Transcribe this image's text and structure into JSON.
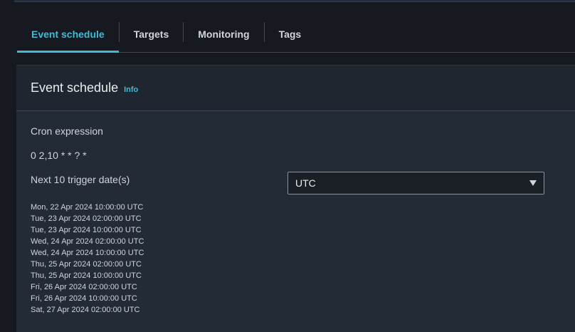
{
  "tabs": [
    {
      "label": "Event schedule",
      "active": true
    },
    {
      "label": "Targets",
      "active": false
    },
    {
      "label": "Monitoring",
      "active": false
    },
    {
      "label": "Tags",
      "active": false
    }
  ],
  "panel": {
    "title": "Event schedule",
    "info_label": "Info",
    "cron_label": "Cron expression",
    "cron_value": "0 2,10 * * ? *",
    "trigger_label": "Next 10 trigger date(s)",
    "timezone": {
      "selected": "UTC",
      "icon": "caret-down-icon"
    },
    "trigger_dates": [
      "Mon, 22 Apr 2024 10:00:00 UTC",
      "Tue, 23 Apr 2024 02:00:00 UTC",
      "Tue, 23 Apr 2024 10:00:00 UTC",
      "Wed, 24 Apr 2024 02:00:00 UTC",
      "Wed, 24 Apr 2024 10:00:00 UTC",
      "Thu, 25 Apr 2024 02:00:00 UTC",
      "Thu, 25 Apr 2024 10:00:00 UTC",
      "Fri, 26 Apr 2024 02:00:00 UTC",
      "Fri, 26 Apr 2024 10:00:00 UTC",
      "Sat, 27 Apr 2024 02:00:00 UTC"
    ]
  },
  "colors": {
    "accent": "#44b9d6",
    "background": "#16191f",
    "panel": "#232b36",
    "text": "#d1d5db"
  }
}
